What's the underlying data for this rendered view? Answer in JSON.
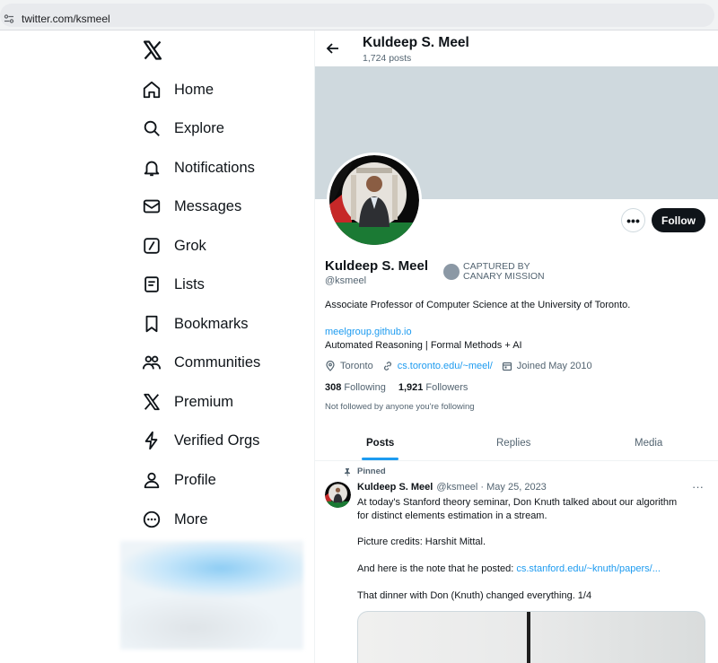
{
  "browser": {
    "url": "twitter.com/ksmeel"
  },
  "sidebar": {
    "items": [
      {
        "label": "Home",
        "icon": "home-icon"
      },
      {
        "label": "Explore",
        "icon": "search-icon"
      },
      {
        "label": "Notifications",
        "icon": "bell-icon"
      },
      {
        "label": "Messages",
        "icon": "envelope-icon"
      },
      {
        "label": "Grok",
        "icon": "grok-icon"
      },
      {
        "label": "Lists",
        "icon": "list-icon"
      },
      {
        "label": "Bookmarks",
        "icon": "bookmark-icon"
      },
      {
        "label": "Communities",
        "icon": "people-icon"
      },
      {
        "label": "Premium",
        "icon": "x-logo-icon"
      },
      {
        "label": "Verified Orgs",
        "icon": "lightning-icon"
      },
      {
        "label": "Profile",
        "icon": "person-icon"
      },
      {
        "label": "More",
        "icon": "more-circle-icon"
      }
    ]
  },
  "header": {
    "name": "Kuldeep S. Meel",
    "post_count": "1,724 posts"
  },
  "profile": {
    "name": "Kuldeep S. Meel",
    "handle": "@ksmeel",
    "badge_line1": "CAPTURED BY",
    "badge_line2": "CANARY MISSION",
    "bio": "Associate Professor of Computer Science at the University of Toronto.",
    "link": "meelgroup.github.io",
    "bio2": "Automated Reasoning | Formal Methods + AI",
    "location": "Toronto",
    "website": "cs.toronto.edu/~meel/",
    "joined": "Joined May 2010",
    "following_count": "308",
    "following_label": "Following",
    "followers_count": "1,921",
    "followers_label": "Followers",
    "not_followed": "Not followed by anyone you're following",
    "follow_label": "Follow",
    "more_label": "•••"
  },
  "tabs": [
    "Posts",
    "Replies",
    "Media"
  ],
  "tweet": {
    "pinned_label": "Pinned",
    "author": "Kuldeep S. Meel",
    "meta": "@ksmeel · May 25, 2023",
    "line1": "At today's Stanford theory seminar, Don Knuth talked about our algorithm",
    "line2": "for distinct elements estimation in a stream.",
    "line3": "Picture credits: Harshit Mittal.",
    "line4_prefix": "And here is the note that he posted: ",
    "line4_link": "cs.stanford.edu/~knuth/papers/...",
    "line5": "That dinner with Don (Knuth) changed everything. 1/4",
    "more_label": "···"
  },
  "colors": {
    "accent": "#1d9bf0",
    "text": "#0f1419",
    "muted": "#536471",
    "banner": "#cfd9de"
  }
}
